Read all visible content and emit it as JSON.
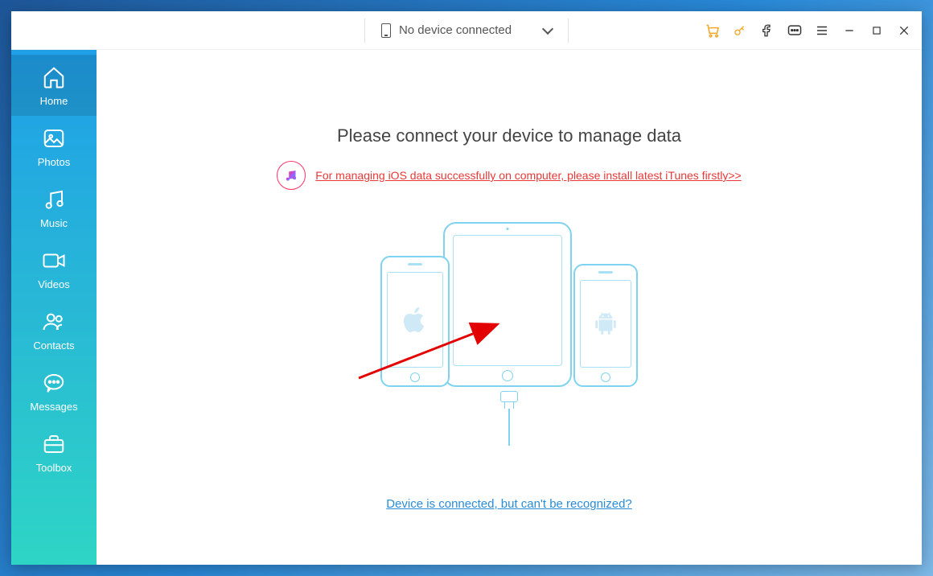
{
  "titlebar": {
    "device_status": "No device connected"
  },
  "sidebar": {
    "items": [
      {
        "label": "Home"
      },
      {
        "label": "Photos"
      },
      {
        "label": "Music"
      },
      {
        "label": "Videos"
      },
      {
        "label": "Contacts"
      },
      {
        "label": "Messages"
      },
      {
        "label": "Toolbox"
      }
    ]
  },
  "main": {
    "headline": "Please connect your device to manage data",
    "itunes_notice": "For managing iOS data successfully on computer, please install latest iTunes firstly>>",
    "recognize_link": "Device is connected, but can't be recognized?"
  },
  "colors": {
    "accent_blue": "#2a8bd6",
    "alert_red": "#e83838",
    "device_outline": "#7fd3f0",
    "cart_orange": "#f5a623"
  }
}
